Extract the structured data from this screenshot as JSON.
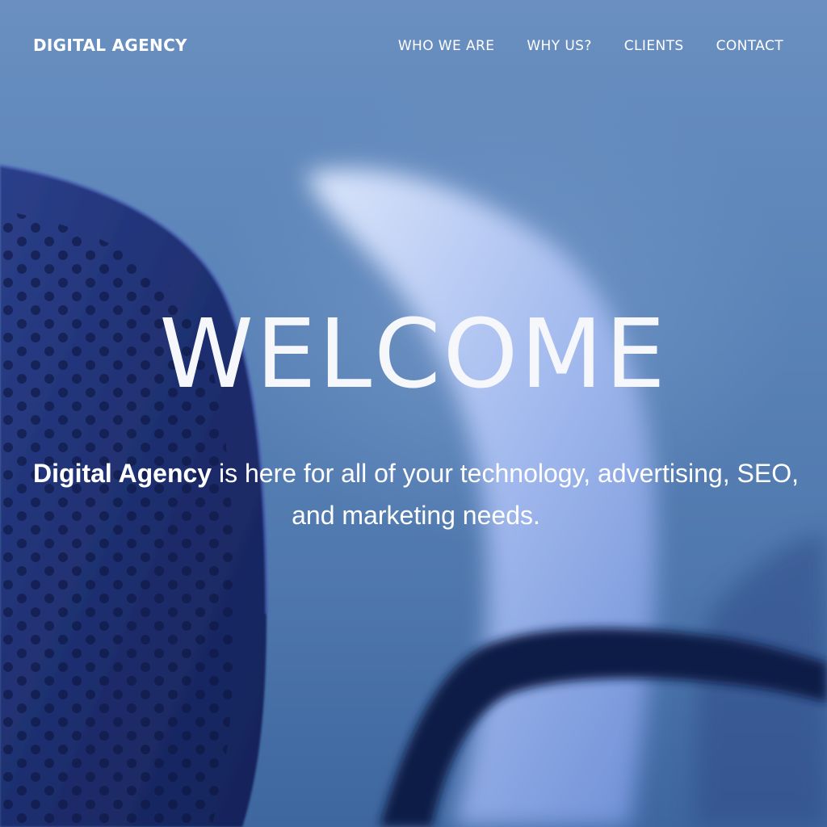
{
  "header": {
    "brand": "DIGITAL AGENCY",
    "nav": [
      {
        "label": "WHO WE ARE"
      },
      {
        "label": "WHY US?"
      },
      {
        "label": "CLIENTS"
      },
      {
        "label": "CONTACT"
      }
    ]
  },
  "hero": {
    "headline": "WELCOME",
    "tagline_brand": "Digital Agency",
    "tagline_rest": " is here for all of your technology, advertising, SEO, and marketing needs."
  },
  "background": {
    "subject": "blurred office chairs",
    "accent": "#4f78ae"
  }
}
